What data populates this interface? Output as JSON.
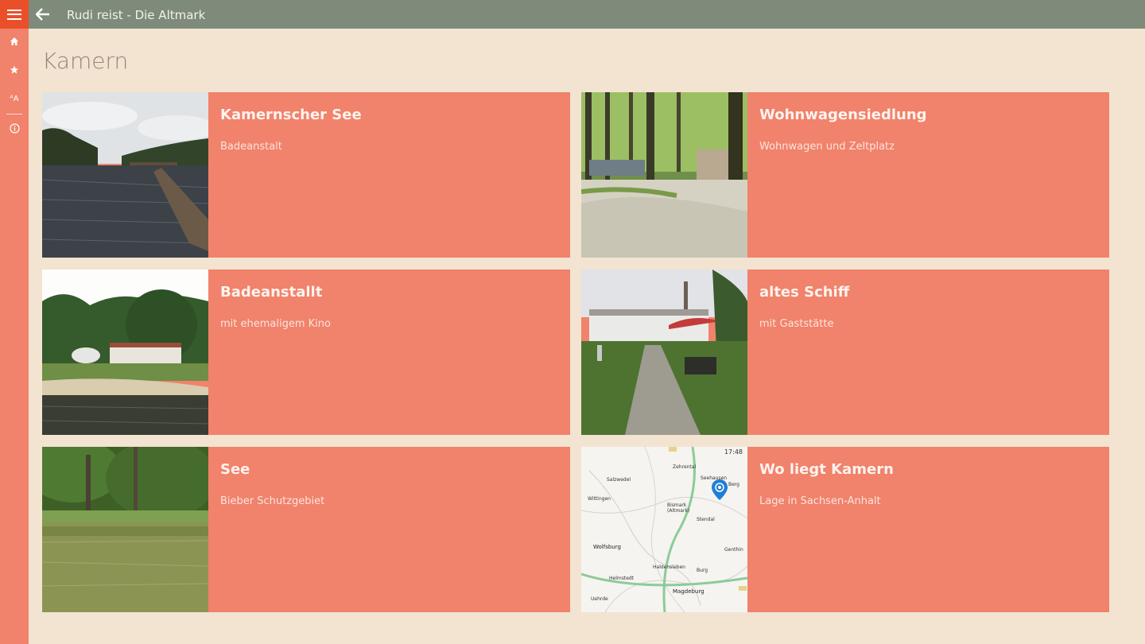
{
  "app": {
    "title": "Rudi reist - Die Altmark"
  },
  "page": {
    "title": "Kamern"
  },
  "sidebar": {
    "items": [
      {
        "name": "home",
        "icon": "home-icon"
      },
      {
        "name": "favorites",
        "icon": "star-icon"
      },
      {
        "name": "font-size",
        "icon": "font-size-icon",
        "label": "ᴬA"
      },
      {
        "name": "info",
        "icon": "info-icon"
      }
    ]
  },
  "map": {
    "time": "17:48",
    "places": [
      "Salzwedel",
      "Wittingen",
      "Bismark (Altmark)",
      "Stendal",
      "Wolfsburg",
      "Haldensleben",
      "Burg",
      "Magdeburg",
      "Genthin",
      "Helmstedt",
      "Uehrde",
      "Zehrental",
      "Seehausen",
      "Berg"
    ]
  },
  "cards": [
    {
      "title": "Kamernscher See",
      "subtitle": "Badeanstalt",
      "image": "lake-pier-photo"
    },
    {
      "title": "Wohnwagensiedlung",
      "subtitle": "Wohnwagen und Zeltplatz",
      "image": "forest-campsite-photo"
    },
    {
      "title": "Badeanstallt",
      "subtitle": "mit ehemaligem Kino",
      "image": "beach-building-photo"
    },
    {
      "title": "altes Schiff",
      "subtitle": "mit Gaststätte",
      "image": "restaurant-garden-photo"
    },
    {
      "title": "See",
      "subtitle": "Bieber Schutzgebiet",
      "image": "green-lake-photo"
    },
    {
      "title": "Wo liegt Kamern",
      "subtitle": "Lage in Sachsen-Anhalt",
      "image": "location-map"
    }
  ],
  "colors": {
    "accent": "#e9502a",
    "sidebar": "#f1826b",
    "topbar": "#7f8b7a",
    "background": "#f3e3d1",
    "card": "#f1826b"
  }
}
